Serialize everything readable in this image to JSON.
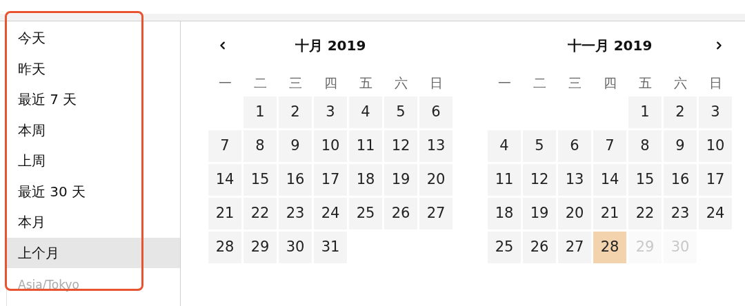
{
  "sidebar": {
    "items": [
      {
        "label": "今天",
        "selected": false
      },
      {
        "label": "昨天",
        "selected": false
      },
      {
        "label": "最近 7 天",
        "selected": false
      },
      {
        "label": "本周",
        "selected": false
      },
      {
        "label": "上周",
        "selected": false
      },
      {
        "label": "最近 30 天",
        "selected": false
      },
      {
        "label": "本月",
        "selected": false
      },
      {
        "label": "上个月",
        "selected": true
      }
    ],
    "timezone": "Asia/Tokyo"
  },
  "calendars": [
    {
      "title": "十月 2019",
      "prev_button": true,
      "next_button": false,
      "weekdays": [
        "一",
        "二",
        "三",
        "四",
        "五",
        "六",
        "日"
      ],
      "days": [
        {
          "kind": "blank"
        },
        {
          "label": "1",
          "kind": "day"
        },
        {
          "label": "2",
          "kind": "day"
        },
        {
          "label": "3",
          "kind": "day"
        },
        {
          "label": "4",
          "kind": "day"
        },
        {
          "label": "5",
          "kind": "day"
        },
        {
          "label": "6",
          "kind": "day"
        },
        {
          "label": "7",
          "kind": "day"
        },
        {
          "label": "8",
          "kind": "day"
        },
        {
          "label": "9",
          "kind": "day"
        },
        {
          "label": "10",
          "kind": "day"
        },
        {
          "label": "11",
          "kind": "day"
        },
        {
          "label": "12",
          "kind": "day"
        },
        {
          "label": "13",
          "kind": "day"
        },
        {
          "label": "14",
          "kind": "day"
        },
        {
          "label": "15",
          "kind": "day"
        },
        {
          "label": "16",
          "kind": "day"
        },
        {
          "label": "17",
          "kind": "day"
        },
        {
          "label": "18",
          "kind": "day"
        },
        {
          "label": "19",
          "kind": "day"
        },
        {
          "label": "20",
          "kind": "day"
        },
        {
          "label": "21",
          "kind": "day"
        },
        {
          "label": "22",
          "kind": "day"
        },
        {
          "label": "23",
          "kind": "day"
        },
        {
          "label": "24",
          "kind": "day"
        },
        {
          "label": "25",
          "kind": "day"
        },
        {
          "label": "26",
          "kind": "day"
        },
        {
          "label": "27",
          "kind": "day"
        },
        {
          "label": "28",
          "kind": "day"
        },
        {
          "label": "29",
          "kind": "day"
        },
        {
          "label": "30",
          "kind": "day"
        },
        {
          "label": "31",
          "kind": "day"
        }
      ]
    },
    {
      "title": "十一月 2019",
      "prev_button": false,
      "next_button": true,
      "weekdays": [
        "一",
        "二",
        "三",
        "四",
        "五",
        "六",
        "日"
      ],
      "days": [
        {
          "kind": "blank"
        },
        {
          "kind": "blank"
        },
        {
          "kind": "blank"
        },
        {
          "kind": "blank"
        },
        {
          "label": "1",
          "kind": "day"
        },
        {
          "label": "2",
          "kind": "day"
        },
        {
          "label": "3",
          "kind": "day"
        },
        {
          "label": "4",
          "kind": "day"
        },
        {
          "label": "5",
          "kind": "day"
        },
        {
          "label": "6",
          "kind": "day"
        },
        {
          "label": "7",
          "kind": "day"
        },
        {
          "label": "8",
          "kind": "day"
        },
        {
          "label": "9",
          "kind": "day"
        },
        {
          "label": "10",
          "kind": "day"
        },
        {
          "label": "11",
          "kind": "day"
        },
        {
          "label": "12",
          "kind": "day"
        },
        {
          "label": "13",
          "kind": "day"
        },
        {
          "label": "14",
          "kind": "day"
        },
        {
          "label": "15",
          "kind": "day"
        },
        {
          "label": "16",
          "kind": "day"
        },
        {
          "label": "17",
          "kind": "day"
        },
        {
          "label": "18",
          "kind": "day"
        },
        {
          "label": "19",
          "kind": "day"
        },
        {
          "label": "20",
          "kind": "day"
        },
        {
          "label": "21",
          "kind": "day"
        },
        {
          "label": "22",
          "kind": "day"
        },
        {
          "label": "23",
          "kind": "day"
        },
        {
          "label": "24",
          "kind": "day"
        },
        {
          "label": "25",
          "kind": "day"
        },
        {
          "label": "26",
          "kind": "day"
        },
        {
          "label": "27",
          "kind": "day"
        },
        {
          "label": "28",
          "kind": "today"
        },
        {
          "label": "29",
          "kind": "future"
        },
        {
          "label": "30",
          "kind": "future"
        }
      ]
    }
  ]
}
